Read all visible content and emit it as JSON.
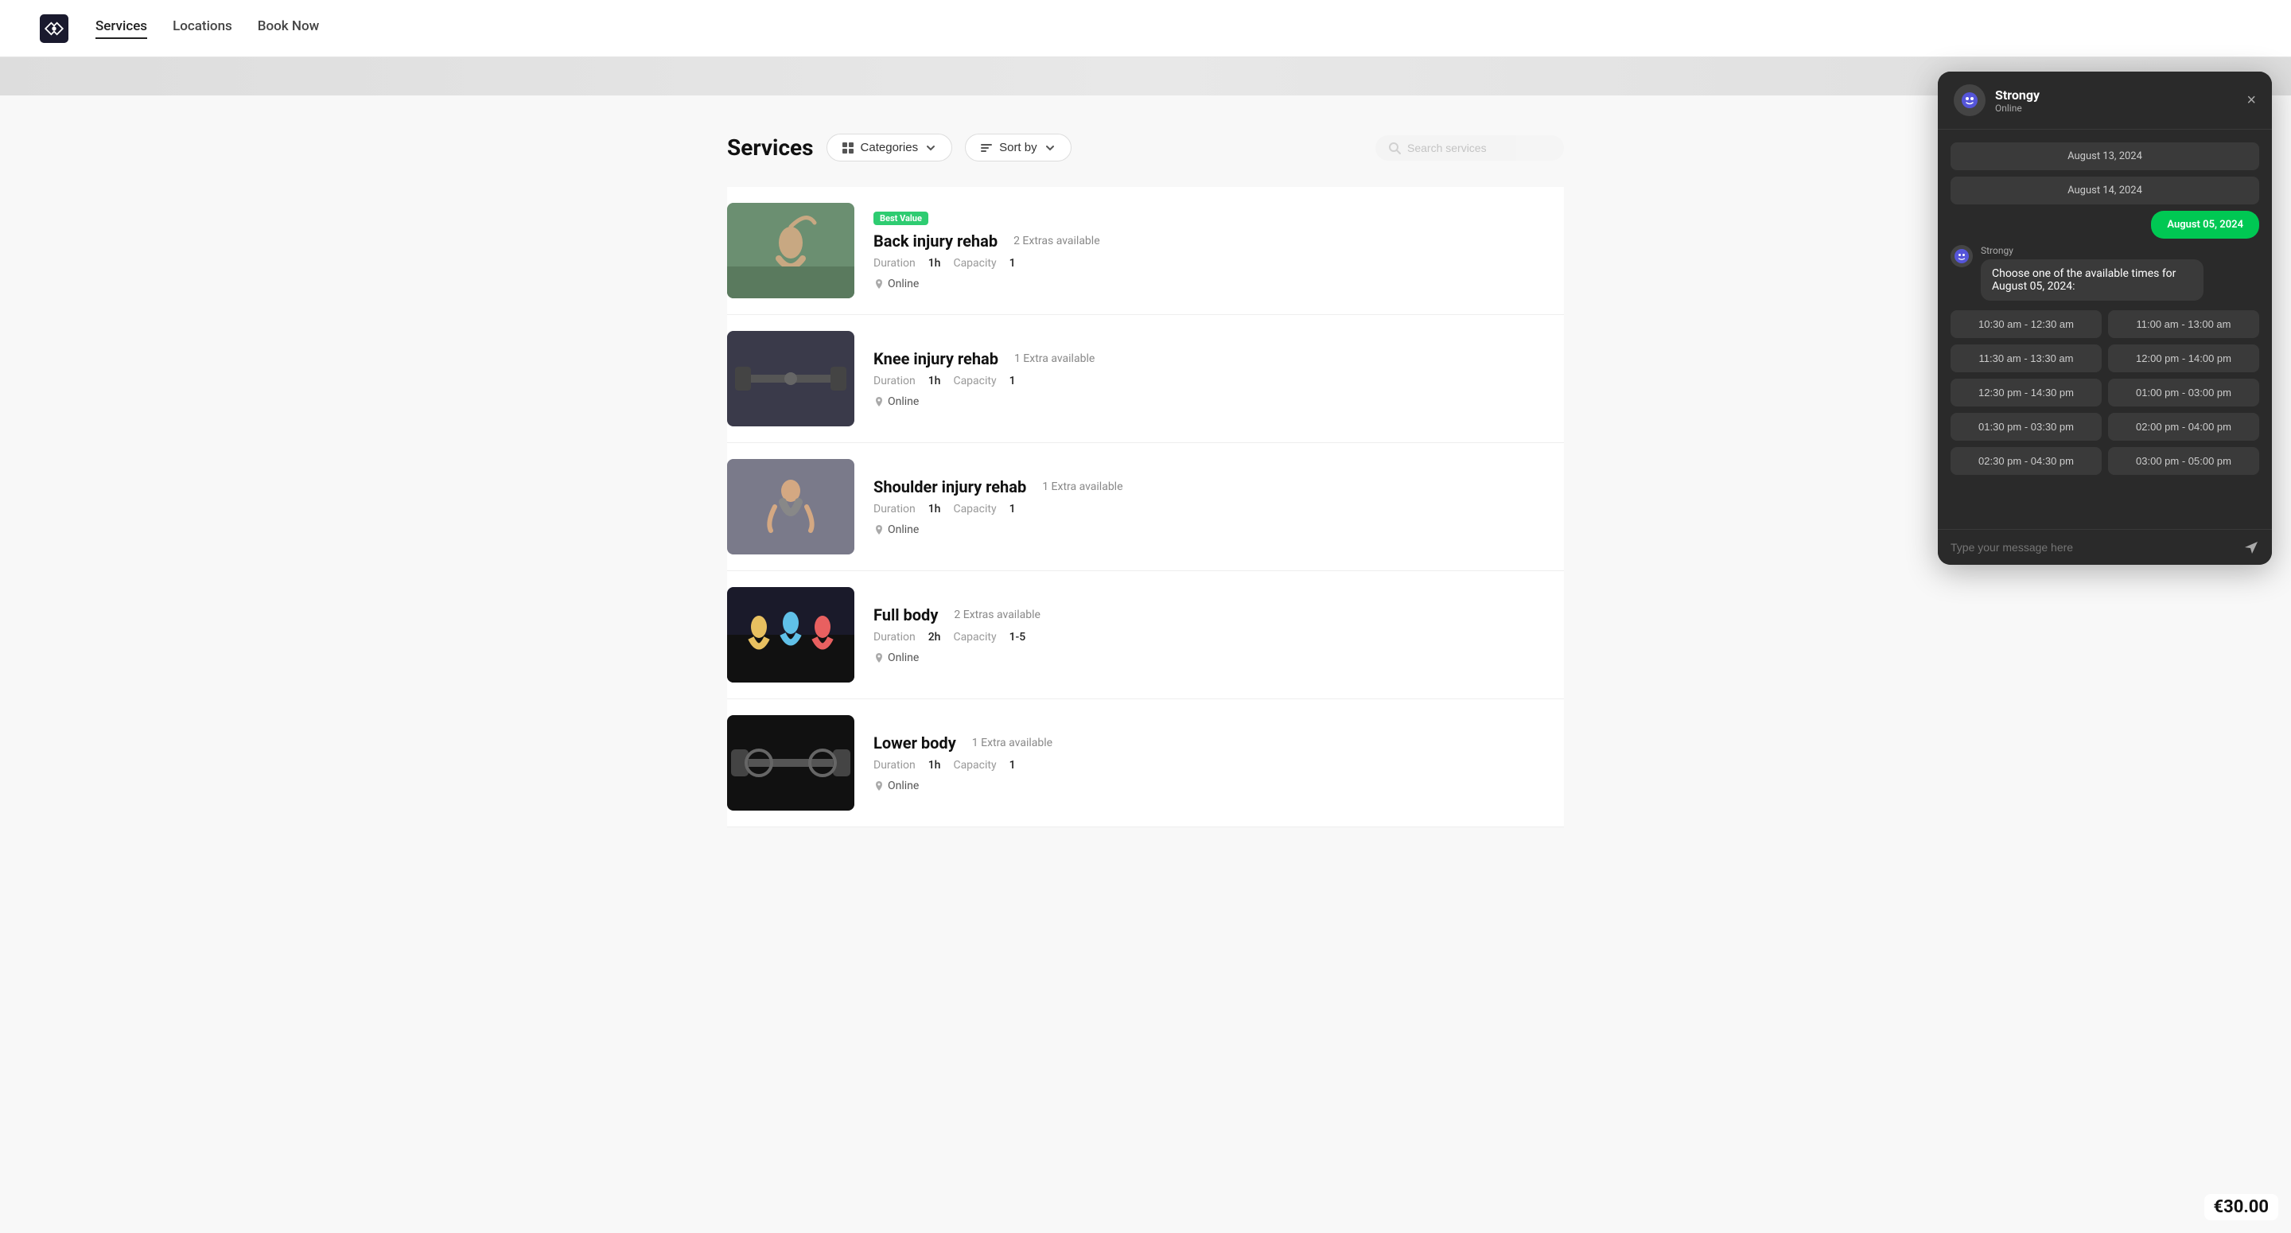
{
  "nav": {
    "logo_alt": "Strongy logo",
    "links": [
      {
        "label": "Services",
        "active": true
      },
      {
        "label": "Locations",
        "active": false
      },
      {
        "label": "Book Now",
        "active": false
      }
    ]
  },
  "page": {
    "title": "Services",
    "filters": {
      "categories_label": "Categories",
      "sort_label": "Sort by"
    },
    "search_placeholder": "Search services"
  },
  "services": [
    {
      "id": 1,
      "name": "Back injury rehab",
      "badge": "Best Value",
      "extras": "2 Extras available",
      "duration": "1h",
      "capacity": "1",
      "location": "Online",
      "thumb_color": "#7a9e7e",
      "thumb_description": "woman stretching outdoors"
    },
    {
      "id": 2,
      "name": "Knee injury rehab",
      "badge": null,
      "extras": "1 Extra available",
      "duration": "1h",
      "capacity": "1",
      "location": "Online",
      "thumb_color": "#5a5a5a",
      "thumb_description": "weights on floor indoors"
    },
    {
      "id": 3,
      "name": "Shoulder injury rehab",
      "badge": null,
      "extras": "1 Extra available",
      "duration": "1h",
      "capacity": "1",
      "location": "Online",
      "thumb_color": "#8a8a8a",
      "thumb_description": "woman doing exercise"
    },
    {
      "id": 4,
      "name": "Full body",
      "badge": null,
      "extras": "2 Extras available",
      "duration": "2h",
      "capacity": "1-5",
      "location": "Online",
      "thumb_color": "#2a2a2a",
      "thumb_description": "group fitness class"
    },
    {
      "id": 5,
      "name": "Lower body",
      "badge": null,
      "extras": "1 Extra available",
      "duration": "1h",
      "capacity": "1",
      "location": "Online",
      "thumb_color": "#1a1a1a",
      "thumb_description": "weights on barbell"
    }
  ],
  "chat": {
    "bot_name": "Strongy",
    "bot_status": "Online",
    "dates": [
      {
        "label": "August 13, 2024",
        "selected": false
      },
      {
        "label": "August 14, 2024",
        "selected": false
      },
      {
        "label": "August 05, 2024",
        "selected": true,
        "active": true
      }
    ],
    "bot_message_name": "Strongy",
    "bot_message_text": "Choose one of the available times for August 05, 2024:",
    "time_slots": [
      {
        "start": "10:30 am",
        "end": "12:30 am"
      },
      {
        "start": "11:00 am",
        "end": "13:00 am"
      },
      {
        "start": "11:30 am",
        "end": "13:30 am"
      },
      {
        "start": "12:00 pm",
        "end": "14:00 pm"
      },
      {
        "start": "12:30 pm",
        "end": "14:30 pm"
      },
      {
        "start": "01:00 pm",
        "end": "03:00 pm"
      },
      {
        "start": "01:30 pm",
        "end": "03:30 pm"
      },
      {
        "start": "02:00 pm",
        "end": "04:00 pm"
      },
      {
        "start": "02:30 pm",
        "end": "04:30 pm"
      },
      {
        "start": "03:00 pm",
        "end": "05:00 pm"
      }
    ],
    "input_placeholder": "Type your message here",
    "close_label": "×"
  },
  "price_corner": "€30.00",
  "labels": {
    "duration": "Duration",
    "capacity": "Capacity",
    "online": "Online",
    "best_value": "Best Value"
  }
}
